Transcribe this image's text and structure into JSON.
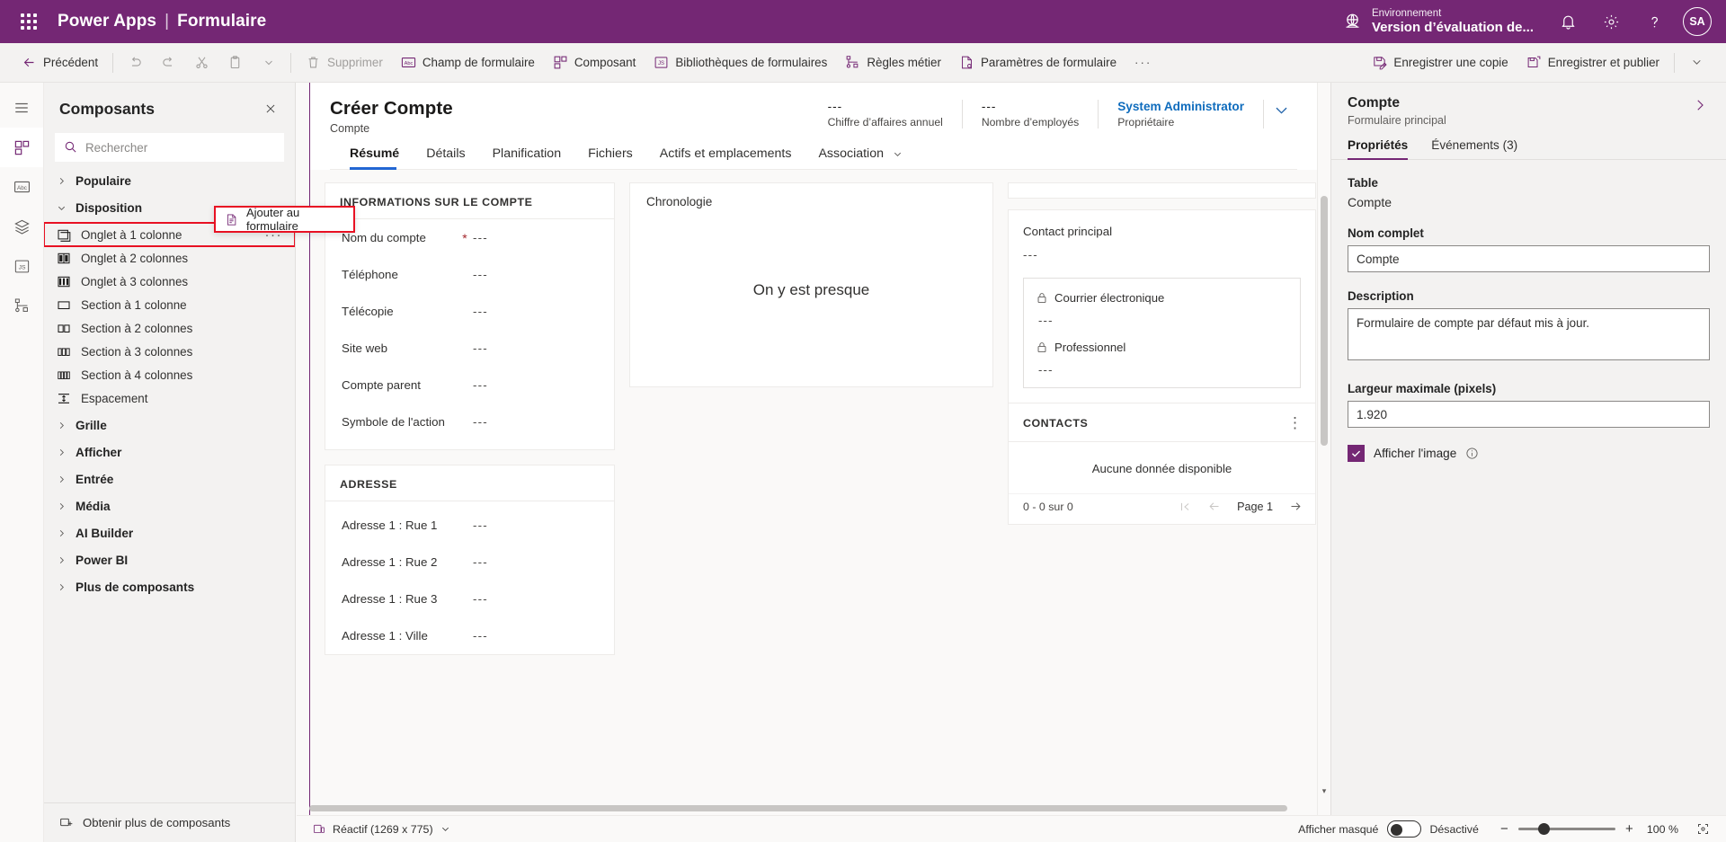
{
  "header": {
    "waffle": "app-launcher",
    "brand": "Power Apps",
    "separator": "|",
    "app_name": "Formulaire",
    "environment_label": "Environnement",
    "environment_name": "Version d’évaluation de...",
    "icons": [
      "globe-icon",
      "bell-icon",
      "gear-icon",
      "help-icon"
    ],
    "avatar_initials": "SA",
    "brand_color": "#742774"
  },
  "command_bar": {
    "back": "Précédent",
    "undo": "undo-icon",
    "redo": "redo-icon",
    "cut": "cut-icon",
    "paste": "paste-icon",
    "paste_chevron": "chevron-down-icon",
    "delete": "Supprimer",
    "form_field": "Champ de formulaire",
    "component": "Composant",
    "form_libraries": "Bibliothèques de formulaires",
    "business_rules": "Règles métier",
    "form_settings": "Paramètres de formulaire",
    "overflow": "···",
    "save_copy": "Enregistrer une copie",
    "save_publish": "Enregistrer et publier",
    "save_chevron": "chevron-down-icon"
  },
  "left_rail": [
    {
      "name": "hamburger-icon",
      "active": false
    },
    {
      "name": "components-icon",
      "active": true
    },
    {
      "name": "form-field-icon",
      "active": false
    },
    {
      "name": "layers-icon",
      "active": false
    },
    {
      "name": "js-icon",
      "active": false
    },
    {
      "name": "business-rules-icon",
      "active": false
    }
  ],
  "components_panel": {
    "title": "Composants",
    "close": "close-icon",
    "search_placeholder": "Rechercher",
    "search_value": "",
    "groups": [
      {
        "label": "Populaire",
        "expanded": false
      },
      {
        "label": "Disposition",
        "expanded": true
      }
    ],
    "layout_items": [
      {
        "label": "Onglet à 1 colonne",
        "icon": "tab-1-column-icon",
        "selected": true,
        "ellipsis": "···"
      },
      {
        "label": "Onglet à 2 colonnes",
        "icon": "tab-2-columns-icon",
        "selected": false
      },
      {
        "label": "Onglet à 3 colonnes",
        "icon": "tab-3-columns-icon",
        "selected": false
      },
      {
        "label": "Section à 1 colonne",
        "icon": "section-1-column-icon",
        "selected": false
      },
      {
        "label": "Section à 2 colonnes",
        "icon": "section-2-columns-icon",
        "selected": false
      },
      {
        "label": "Section à 3 colonnes",
        "icon": "section-3-columns-icon",
        "selected": false
      },
      {
        "label": "Section à 4 colonnes",
        "icon": "section-4-columns-icon",
        "selected": false
      },
      {
        "label": "Espacement",
        "icon": "spacer-icon",
        "selected": false
      }
    ],
    "collapsed_groups": [
      {
        "label": "Grille"
      },
      {
        "label": "Afficher"
      },
      {
        "label": "Entrée"
      },
      {
        "label": "Média"
      },
      {
        "label": "AI Builder"
      },
      {
        "label": "Power BI"
      },
      {
        "label": "Plus de composants"
      }
    ],
    "footer": "Obtenir plus de composants",
    "highlight_color": "#e81123"
  },
  "context_menu": {
    "item": "Ajouter au formulaire",
    "icon": "add-to-form-icon"
  },
  "form": {
    "title": "Créer Compte",
    "subtitle": "Compte",
    "stats": [
      {
        "value": "---",
        "label": "Chiffre d’affaires annuel",
        "is_link": false
      },
      {
        "value": "---",
        "label": "Nombre d’employés",
        "is_link": false
      },
      {
        "value": "System Administrator",
        "label": "Propriétaire",
        "is_link": true
      }
    ],
    "header_chevron": "chevron-down-icon",
    "tabs": [
      {
        "label": "Résumé",
        "active": true,
        "dropdown": false
      },
      {
        "label": "Détails",
        "active": false,
        "dropdown": false
      },
      {
        "label": "Planification",
        "active": false,
        "dropdown": false
      },
      {
        "label": "Fichiers",
        "active": false,
        "dropdown": false
      },
      {
        "label": "Actifs et emplacements",
        "active": false,
        "dropdown": false
      },
      {
        "label": "Association",
        "active": false,
        "dropdown": true
      }
    ],
    "sections": {
      "account_info": {
        "title": "INFORMATIONS SUR LE COMPTE",
        "fields": [
          {
            "label": "Nom du compte",
            "required": true,
            "value": "---"
          },
          {
            "label": "Téléphone",
            "required": false,
            "value": "---"
          },
          {
            "label": "Télécopie",
            "required": false,
            "value": "---"
          },
          {
            "label": "Site web",
            "required": false,
            "value": "---"
          },
          {
            "label": "Compte parent",
            "required": false,
            "value": "---"
          },
          {
            "label": "Symbole de l'action",
            "required": false,
            "value": "---"
          }
        ]
      },
      "address": {
        "title": "ADRESSE",
        "fields": [
          {
            "label": "Adresse 1 : Rue 1",
            "required": false,
            "value": "---"
          },
          {
            "label": "Adresse 1 : Rue 2",
            "required": false,
            "value": "---"
          },
          {
            "label": "Adresse 1 : Rue 3",
            "required": false,
            "value": "---"
          },
          {
            "label": "Adresse 1 : Ville",
            "required": false,
            "value": "---"
          }
        ]
      },
      "timeline": {
        "title": "Chronologie",
        "empty_text": "On y est presque"
      },
      "contact": {
        "label": "Contact principal",
        "value": "---",
        "email_label": "Courrier électronique",
        "email_value": "---",
        "business_label": "Professionnel",
        "business_value": "---",
        "lock_icon": "lock-icon"
      },
      "contacts": {
        "title": "CONTACTS",
        "more": "more-vertical-icon",
        "empty": "Aucune donnée disponible",
        "count": "0 - 0 sur 0",
        "page_label": "Page 1",
        "first_icon": "page-first-icon",
        "prev_icon": "page-prev-icon",
        "next_icon": "page-next-icon"
      }
    }
  },
  "properties_panel": {
    "title": "Compte",
    "subtitle": "Formulaire principal",
    "collapse_icon": "chevron-right-icon",
    "tabs": [
      {
        "label": "Propriétés",
        "active": true
      },
      {
        "label": "Événements (3)",
        "active": false
      }
    ],
    "table_label": "Table",
    "table_value": "Compte",
    "fullname_label": "Nom complet",
    "fullname_value": "Compte",
    "description_label": "Description",
    "description_value": "Formulaire de compte par défaut mis à jour.",
    "maxwidth_label": "Largeur maximale (pixels)",
    "maxwidth_value": "1.920",
    "show_image_label": "Afficher l'image",
    "show_image_checked": true,
    "info_icon": "info-icon",
    "accent_color": "#742774"
  },
  "status_bar": {
    "responsive": "Réactif (1269 x 775)",
    "responsive_chevron": "chevron-down-icon",
    "show_hidden_label": "Afficher masqué",
    "toggle_state": "Désactivé",
    "zoom_out": "−",
    "zoom_in": "+",
    "zoom_level": "100 %",
    "fit_icon": "fit-to-screen-icon"
  }
}
